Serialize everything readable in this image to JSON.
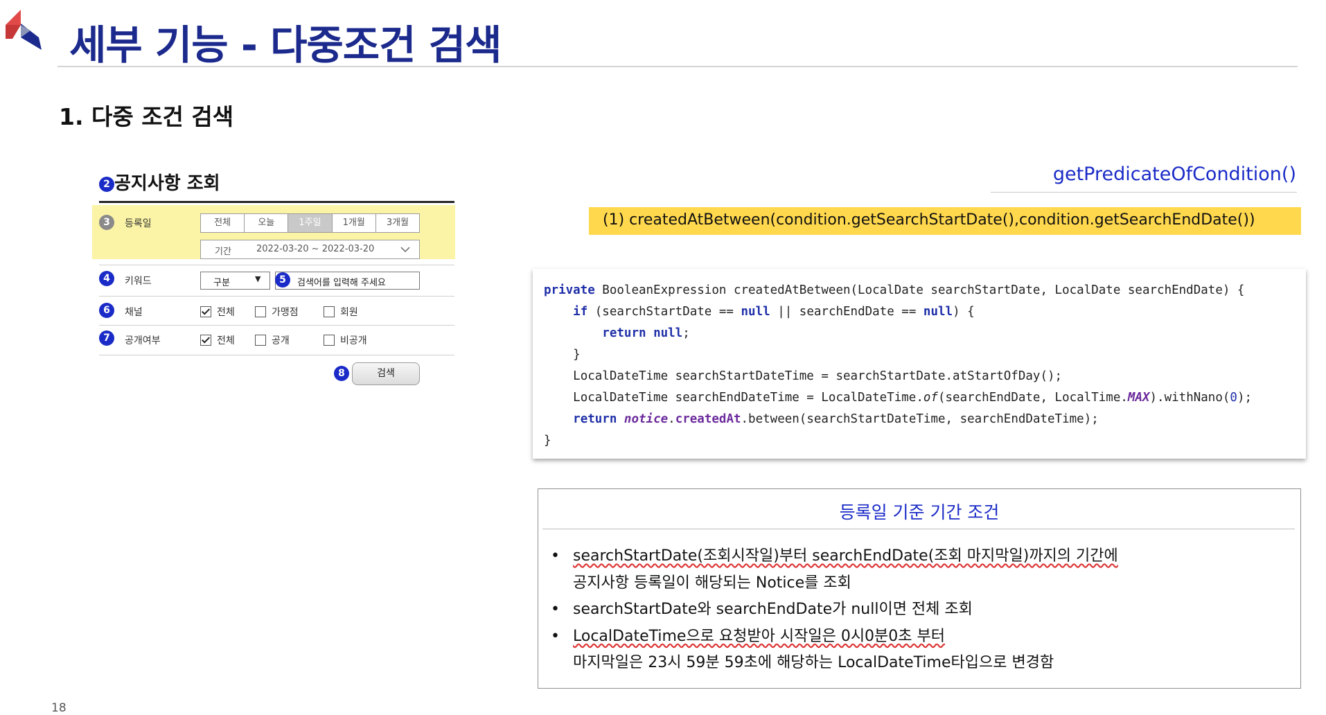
{
  "slide_title": "세부 기능 - 다중조건 검색",
  "section_heading": "1.  다중 조건 검색",
  "form": {
    "title": "공지사항 조회",
    "title_num": "2",
    "rows": {
      "date": {
        "num": "3",
        "label": "등록일",
        "segments": [
          "전체",
          "오늘",
          "1주일",
          "1개월",
          "3개월"
        ],
        "active": "1주일",
        "period_label": "기간",
        "period_value": "2022-03-20 ~ 2022-03-20"
      },
      "keyword": {
        "num": "4",
        "label": "키워드",
        "select_value": "구분",
        "input_num": "5",
        "input_placeholder": "검색어를 입력해 주세요"
      },
      "channel": {
        "num": "6",
        "label": "채널",
        "options": [
          "전체",
          "가맹점",
          "회원"
        ]
      },
      "public": {
        "num": "7",
        "label": "공개여부",
        "options": [
          "전체",
          "공개",
          "비공개"
        ]
      }
    },
    "search_num": "8",
    "search_label": "검색"
  },
  "method_name": "getPredicateOfCondition()",
  "highlight_line": "(1) createdAtBetween(condition.getSearchStartDate(),condition.getSearchEndDate())",
  "code": {
    "l1_kw": "private",
    "l1_rest": " BooleanExpression createdAtBetween(LocalDate searchStartDate, LocalDate searchEndDate) {",
    "l2_kw": "if",
    "l2_a": " (searchStartDate == ",
    "l2_null1": "null",
    "l2_b": " || searchEndDate == ",
    "l2_null2": "null",
    "l2_c": ") {",
    "l3_kw": "return",
    "l3_null": "null",
    "l3_c": ";",
    "l4": "}",
    "l5": "LocalDateTime searchStartDateTime = searchStartDate.atStartOfDay();",
    "l6_a": "LocalDateTime searchEndDateTime = LocalDateTime.",
    "l6_of": "of",
    "l6_b": "(searchEndDate, LocalTime.",
    "l6_max": "MAX",
    "l6_c": ").withNano(",
    "l6_zero": "0",
    "l6_d": ");",
    "l7_kw": "return",
    "l7_notice": "notice",
    "l7_dot": ".",
    "l7_created": "createdAt",
    "l7_rest": ".between(searchStartDateTime, searchEndDateTime);",
    "l8": "}"
  },
  "condition": {
    "title": "등록일 기준 기간 조건",
    "bullet": "•",
    "b1_line1": "searchStartDate(조회시작일)부터 searchEndDate(조회 마지막일)까지의 기간에",
    "b1_line2": "공지사항 등록일이 해당되는 Notice를 조회",
    "b2": "searchStartDate와 searchEndDate가 null이면 전체 조회",
    "b3_line1": "LocalDateTime으로 요청받아 시작일은 0시0분0초 부터",
    "b3_line2": "마지막일은 23시 59분 59초에 해당하는 LocalDateTime타입으로 변경함"
  },
  "page_number": "18",
  "colors": {
    "title_blue": "#1b2a8c",
    "accent_blue": "#1a2bc7",
    "highlight_yellow": "#ffd84d",
    "form_highlight": "#fbf4a6",
    "logo_red": "#d94a4a"
  }
}
